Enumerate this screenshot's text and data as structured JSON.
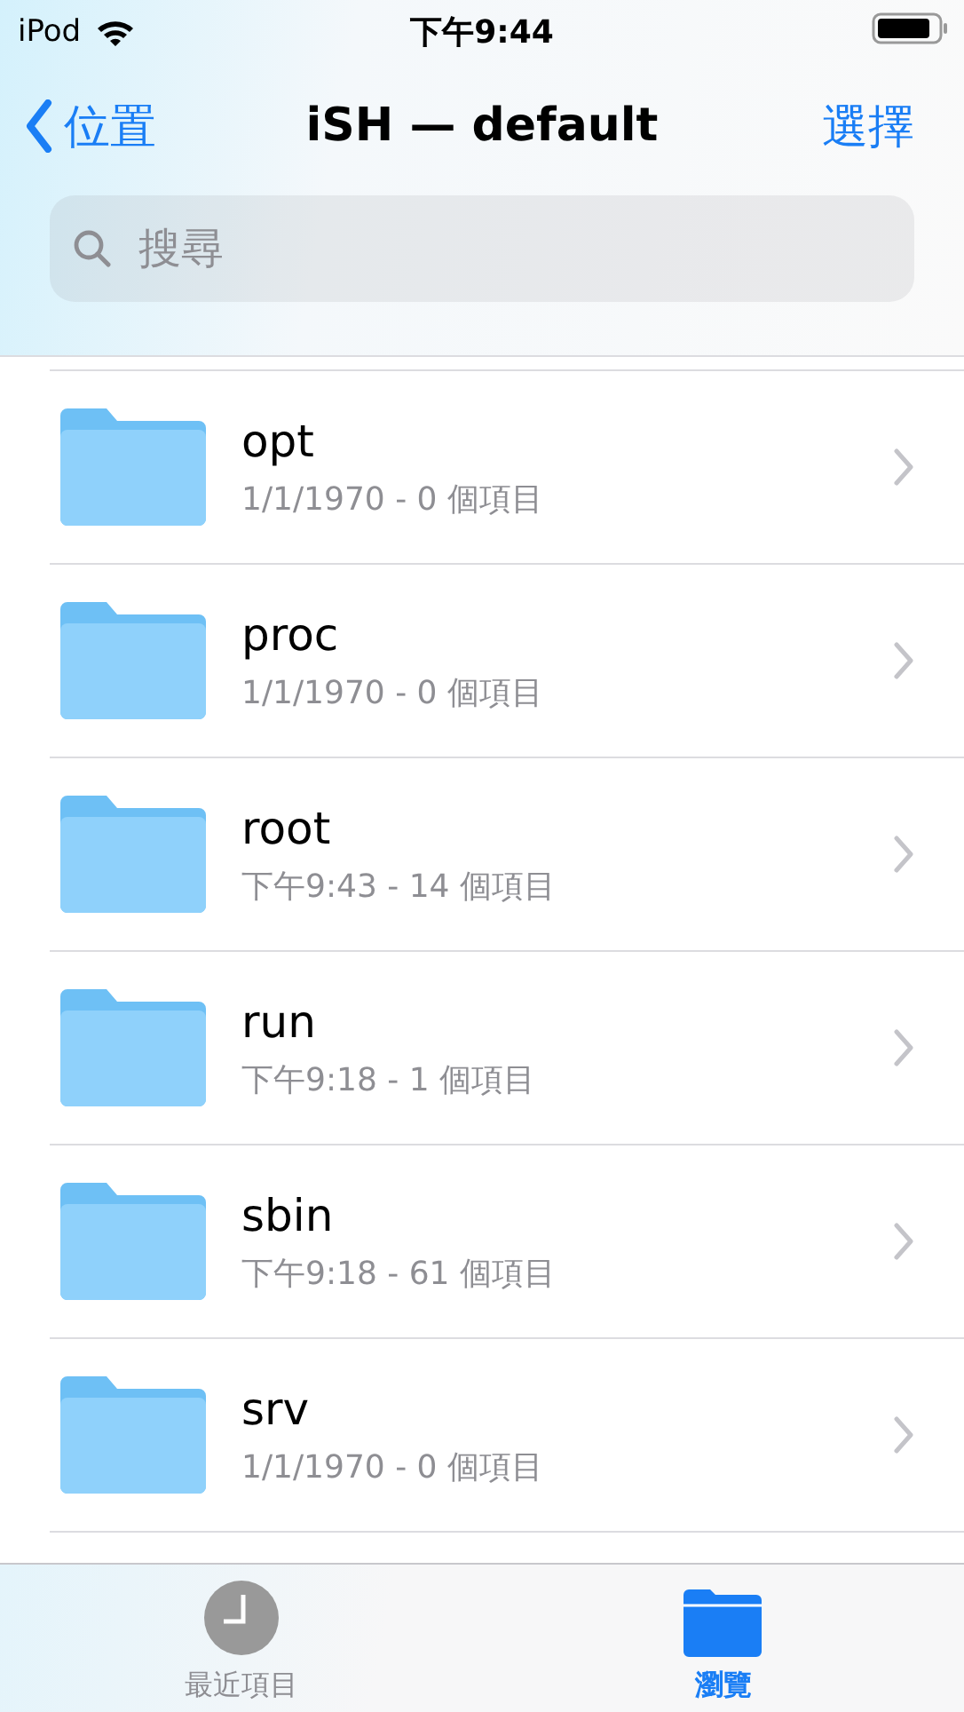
{
  "status_bar": {
    "carrier": "iPod",
    "time": "下午9:44"
  },
  "nav": {
    "back": "位置",
    "title": "iSH — default",
    "action": "選擇"
  },
  "search": {
    "placeholder": "搜尋"
  },
  "folders": [
    {
      "name": "opt",
      "detail": "1/1/1970 - 0 個項目"
    },
    {
      "name": "proc",
      "detail": "1/1/1970 - 0 個項目"
    },
    {
      "name": "root",
      "detail": "下午9:43 - 14 個項目"
    },
    {
      "name": "run",
      "detail": "下午9:18 - 1 個項目"
    },
    {
      "name": "sbin",
      "detail": "下午9:18 - 61 個項目"
    },
    {
      "name": "srv",
      "detail": "1/1/1970 - 0 個項目"
    }
  ],
  "tabs": [
    {
      "label": "最近項目",
      "kind": "clock",
      "selected": false
    },
    {
      "label": "瀏覽",
      "kind": "folder",
      "selected": true
    }
  ]
}
